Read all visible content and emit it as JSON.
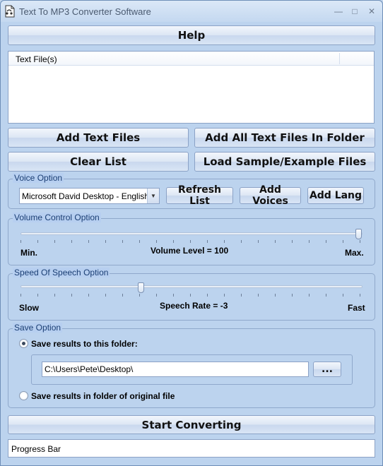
{
  "window": {
    "title": "Text To MP3 Converter Software",
    "minimize_glyph": "—",
    "maximize_glyph": "□",
    "close_glyph": "✕"
  },
  "toolbar": {
    "help_label": "Help"
  },
  "file_list": {
    "column_header": "Text File(s)",
    "items": []
  },
  "file_actions": {
    "add_text_files": "Add Text Files",
    "add_all_in_folder": "Add All Text Files In Folder",
    "clear_list": "Clear List",
    "load_sample": "Load Sample/Example Files"
  },
  "voice_option": {
    "group_label": "Voice Option",
    "selected_voice": "Microsoft David Desktop - English",
    "refresh_list": "Refresh List",
    "add_voices": "Add Voices",
    "add_lang": "Add Lang"
  },
  "volume": {
    "group_label": "Volume Control Option",
    "min_label": "Min.",
    "max_label": "Max.",
    "level_text": "Volume Level = 100",
    "level_value": 100,
    "level_range": [
      0,
      100
    ]
  },
  "speed": {
    "group_label": "Speed Of Speech Option",
    "slow_label": "Slow",
    "fast_label": "Fast",
    "rate_text": "Speech Rate = -3",
    "rate_value": -3,
    "rate_range": [
      -10,
      10
    ]
  },
  "save_option": {
    "group_label": "Save Option",
    "save_to_folder_label": "Save results to this folder:",
    "folder_path": "C:\\Users\\Pete\\Desktop\\",
    "browse_label": "...",
    "save_in_original_label": "Save results in folder of original file",
    "selected": "folder"
  },
  "actions": {
    "start_converting": "Start Converting"
  },
  "progress": {
    "label": "Progress Bar",
    "value": 0
  },
  "colors": {
    "window_bg": "#b7cff0",
    "group_label": "#1a3e73",
    "border": "#8ba2c6"
  }
}
